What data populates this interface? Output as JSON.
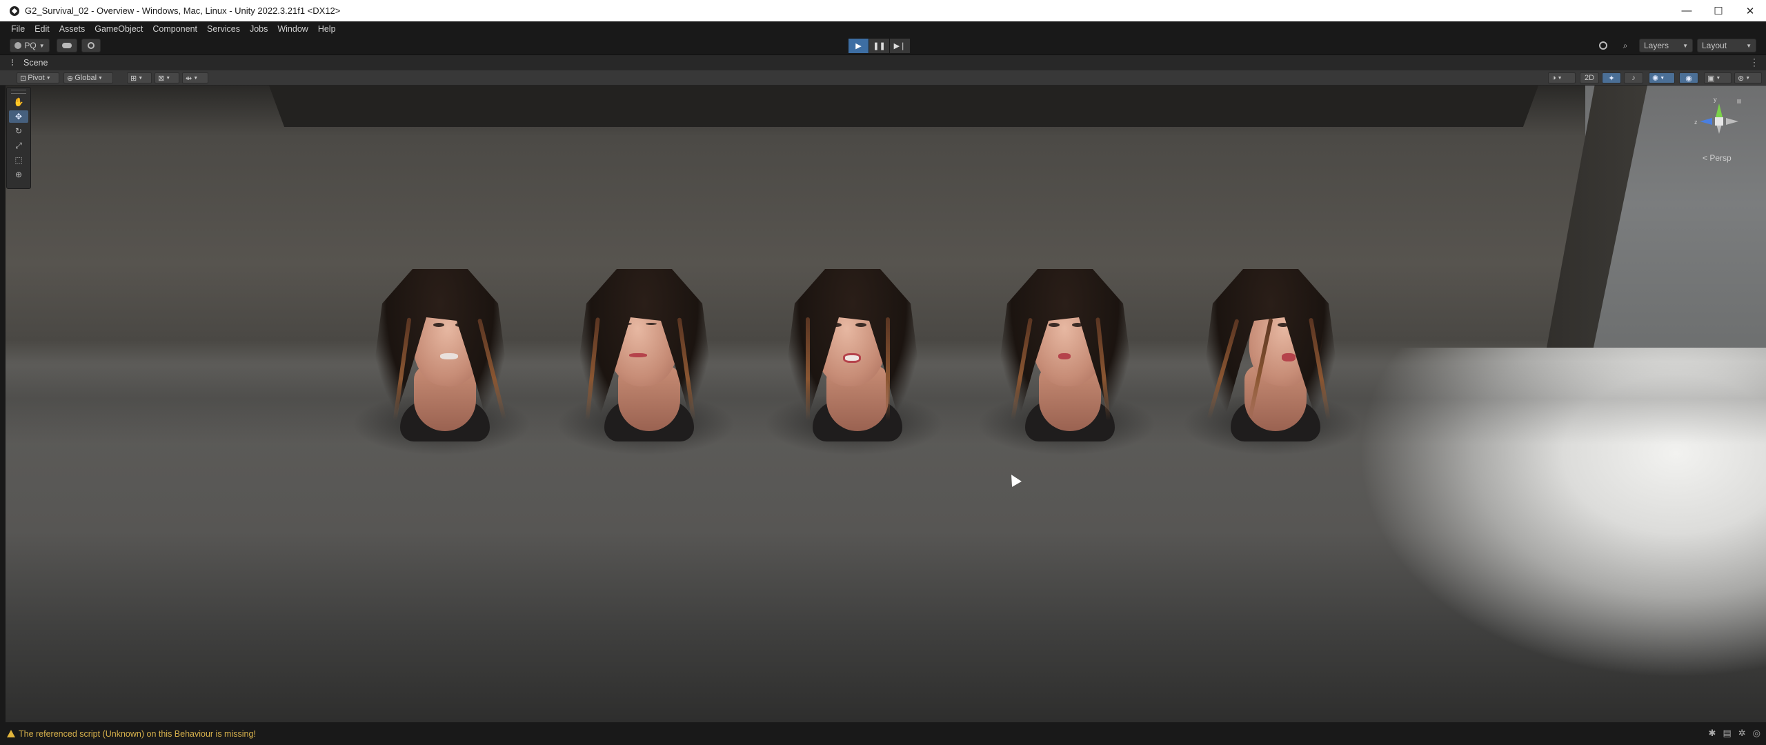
{
  "window": {
    "title": "G2_Survival_02 - Overview - Windows, Mac, Linux - Unity 2022.3.21f1 <DX12>",
    "controls": [
      "—",
      "☐",
      "✕"
    ]
  },
  "menu": [
    "File",
    "Edit",
    "Assets",
    "GameObject",
    "Component",
    "Services",
    "Jobs",
    "Window",
    "Help"
  ],
  "toolbar": {
    "account": "PQ",
    "play": "▶",
    "pause": "❚❚",
    "step": "▶❘",
    "layers": "Layers",
    "layout": "Layout"
  },
  "scene": {
    "tab_label": "Scene",
    "pivot": "Pivot",
    "global": "Global",
    "mode_2d": "2D",
    "persp": "< Persp",
    "gizmo_axes": [
      "y",
      "z"
    ]
  },
  "status": {
    "message": "The referenced script (Unknown) on this Behaviour is missing!"
  },
  "colors": {
    "accent": "#3d6ea3",
    "warning": "#e2b53c",
    "gizmo_y": "#7bd34a",
    "gizmo_z": "#4a7fe0"
  }
}
